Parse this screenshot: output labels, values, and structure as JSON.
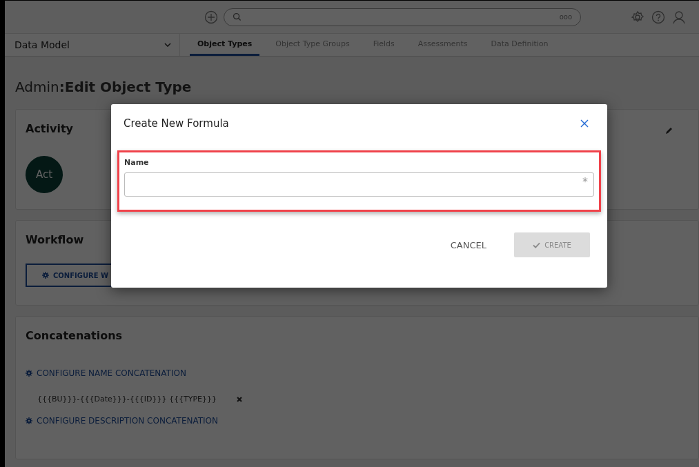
{
  "top_bar": {
    "more": "ooo"
  },
  "nav": {
    "dropdown": "Data Model",
    "tabs": [
      {
        "label": "Object Types",
        "selected": true
      },
      {
        "label": "Object Type Groups",
        "selected": false
      },
      {
        "label": "Fields",
        "selected": false
      },
      {
        "label": "Assessments",
        "selected": false
      },
      {
        "label": "Data Definition",
        "selected": false
      }
    ]
  },
  "heading": "Admin**:Edit Object Type**",
  "sections": [
    {
      "kind": "activity",
      "title": "Activity",
      "avatar": "Act"
    },
    {
      "kind": "workflow",
      "title": "Workflow",
      "button": "CONFIGURE W"
    },
    {
      "kind": "concatenations",
      "title": "Concatenations",
      "links": [
        "CONFIGURE NAME CONCATENATION",
        "CONFIGURE DESCRIPTION CONCATENATION"
      ],
      "value": "{{{BU}}}-{{{Date}}}-{{{ID}}} {{{TYPE}}}"
    }
  ],
  "modal": {
    "title": "Create New Formula",
    "field": {
      "label": "Name",
      "required_mark": "*"
    },
    "buttons": [
      {
        "kind": "cancel",
        "label": "CANCEL",
        "disabled": false
      },
      {
        "kind": "create",
        "label": "CREATE",
        "disabled": true
      }
    ]
  }
}
